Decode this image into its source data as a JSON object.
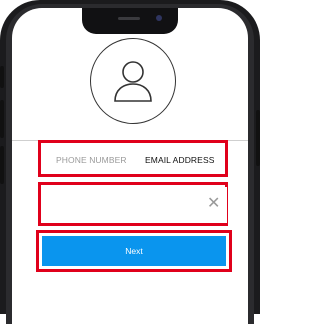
{
  "login": {
    "tabs": {
      "phone_label": "PHONE NUMBER",
      "email_label": "EMAIL ADDRESS",
      "selected": "email"
    },
    "input": {
      "value": "",
      "placeholder": "",
      "clear_icon": "close-icon"
    },
    "next_label": "Next"
  },
  "colors": {
    "primary_button": "#0a95ee",
    "highlight": "#e0001b"
  }
}
